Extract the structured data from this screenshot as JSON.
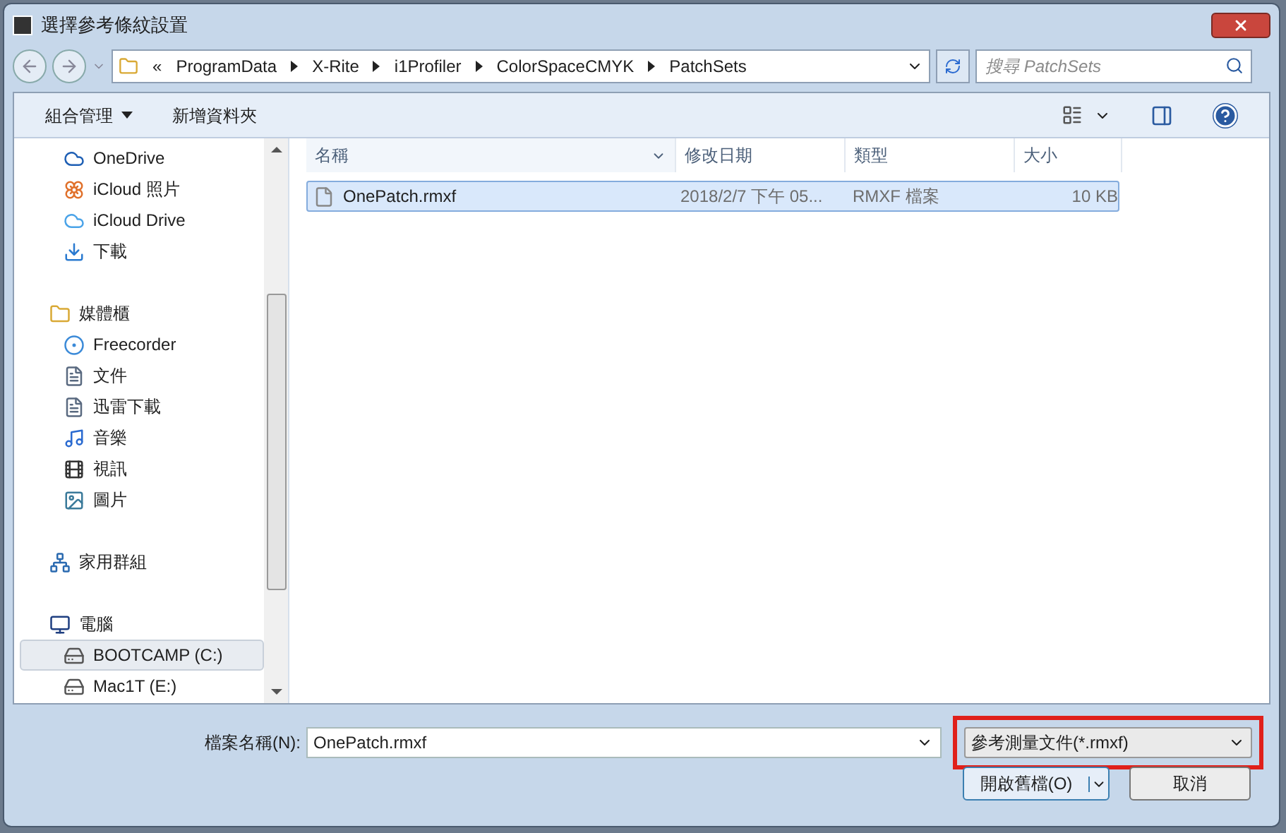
{
  "window": {
    "title": "選擇參考條紋設置"
  },
  "address_bar": {
    "overflow": "«",
    "crumbs": [
      "ProgramData",
      "X-Rite",
      "i1Profiler",
      "ColorSpaceCMYK",
      "PatchSets"
    ]
  },
  "search": {
    "placeholder": "搜尋 PatchSets"
  },
  "toolbar": {
    "buttons": [
      {
        "label": "組合管理",
        "dropdown": true
      },
      {
        "label": "新增資料夾",
        "dropdown": false
      }
    ]
  },
  "sidebar": {
    "items": [
      {
        "label": "OneDrive",
        "kind": "item",
        "selected": false
      },
      {
        "label": "iCloud 照片",
        "kind": "item",
        "selected": false
      },
      {
        "label": "iCloud Drive",
        "kind": "item",
        "selected": false
      },
      {
        "label": "下載",
        "kind": "item",
        "selected": false
      },
      {
        "label": "媒體櫃",
        "kind": "group",
        "selected": false
      },
      {
        "label": "Freecorder",
        "kind": "item",
        "selected": false
      },
      {
        "label": "文件",
        "kind": "item",
        "selected": false
      },
      {
        "label": "迅雷下載",
        "kind": "item",
        "selected": false
      },
      {
        "label": "音樂",
        "kind": "item",
        "selected": false
      },
      {
        "label": "視訊",
        "kind": "item",
        "selected": false
      },
      {
        "label": "圖片",
        "kind": "item",
        "selected": false
      },
      {
        "label": "家用群組",
        "kind": "group",
        "selected": false
      },
      {
        "label": "電腦",
        "kind": "group",
        "selected": false
      },
      {
        "label": "BOOTCAMP (C:)",
        "kind": "item",
        "selected": true
      },
      {
        "label": "Mac1T (E:)",
        "kind": "item",
        "selected": false
      }
    ]
  },
  "table": {
    "columns": [
      "名稱",
      "修改日期",
      "類型",
      "大小"
    ],
    "rows": [
      {
        "name": "OnePatch.rmxf",
        "modified": "2018/2/7 下午 05...",
        "type": "RMXF 檔案",
        "size": "10 KB",
        "selected": true
      }
    ]
  },
  "footer": {
    "filename_label": "檔案名稱(N):",
    "filename": "OnePatch.rmxf",
    "filetype": "參考測量文件(*.rmxf)",
    "open_button": "開啟舊檔(O)",
    "cancel_button": "取消"
  }
}
